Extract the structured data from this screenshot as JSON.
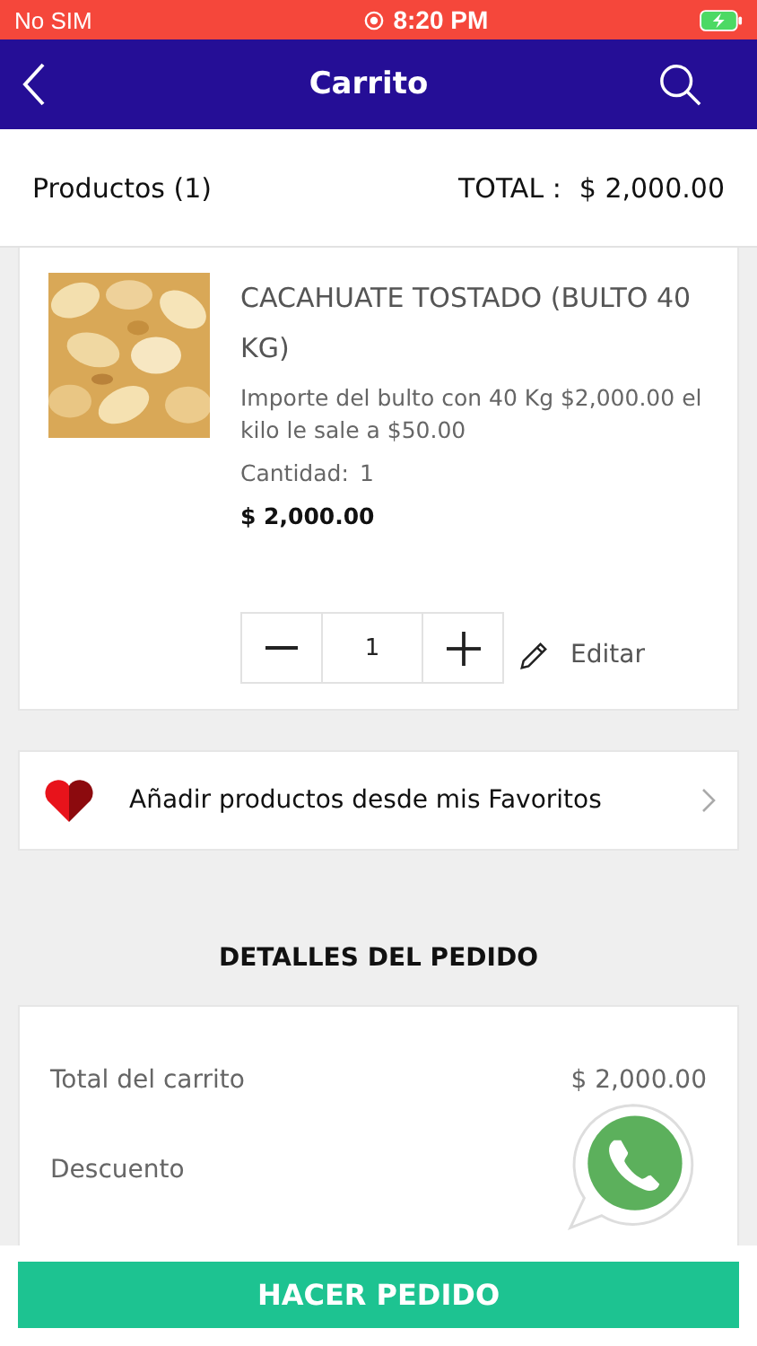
{
  "status_bar": {
    "carrier": "No SIM",
    "time": "8:20 PM"
  },
  "nav": {
    "title": "Carrito"
  },
  "summary": {
    "products": "Productos (1)",
    "total_label": "TOTAL :",
    "total": "$ 2,000.00"
  },
  "cart_items": [
    {
      "name": "CACAHUATE TOSTADO (BULTO 40 KG)",
      "description": "Importe del bulto con 40 Kg  $2,000.00  el kilo le sale a $50.00",
      "quantity_label": "Cantidad:",
      "quantity": "1",
      "price": "$ 2,000.00",
      "stepper_value": "1",
      "edit": "Editar"
    }
  ],
  "favorites": {
    "label": "Añadir productos desde mis Favoritos"
  },
  "details": {
    "title": "DETALLES DEL PEDIDO",
    "rows": [
      {
        "label": "Total del carrito",
        "value": "$ 2,000.00"
      },
      {
        "label": "Descuento"
      }
    ]
  },
  "order_button": "HACER PEDIDO"
}
